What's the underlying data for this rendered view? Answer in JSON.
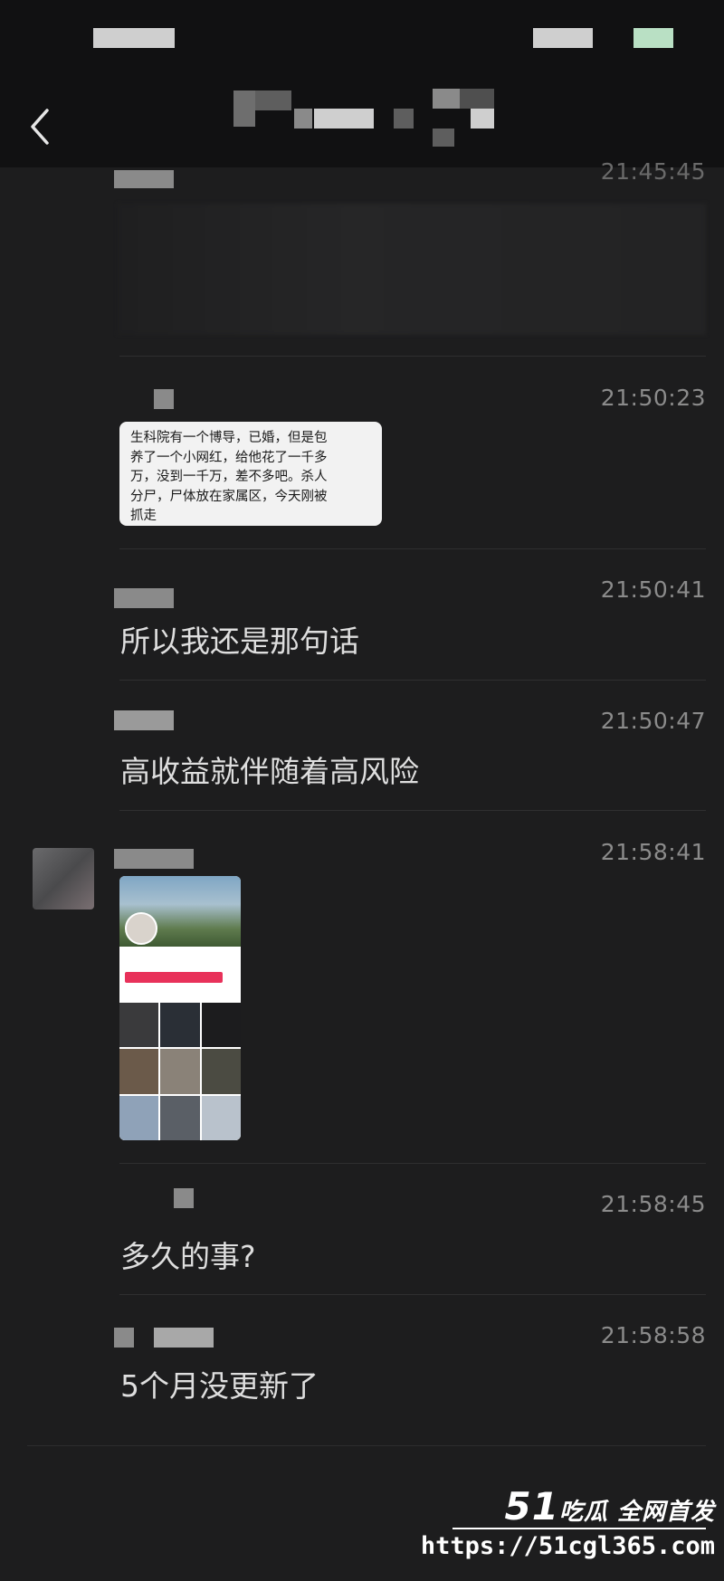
{
  "header": {
    "back_icon": "chevron-left-icon"
  },
  "messages": [
    {
      "time": "21:45:45",
      "text": ""
    },
    {
      "time": "21:50:23",
      "quote_lines": [
        "生科院有一个博导，已婚，但是包",
        "养了一个小网红，给他花了一千多",
        "万，没到一千万，差不多吧。杀人",
        "分尸，尸体放在家属区，今天刚被",
        "抓走"
      ]
    },
    {
      "time": "21:50:41",
      "text": "所以我还是那句话"
    },
    {
      "time": "21:50:47",
      "text": "高收益就伴随着高风险"
    },
    {
      "time": "21:58:41",
      "text": ""
    },
    {
      "time": "21:58:45",
      "text": "多久的事?"
    },
    {
      "time": "21:58:58",
      "text": "5个月没更新了"
    }
  ],
  "watermark": {
    "logo_num": "51",
    "logo_text": "吃瓜 全网首发",
    "url": "https://51cgl365.com"
  }
}
